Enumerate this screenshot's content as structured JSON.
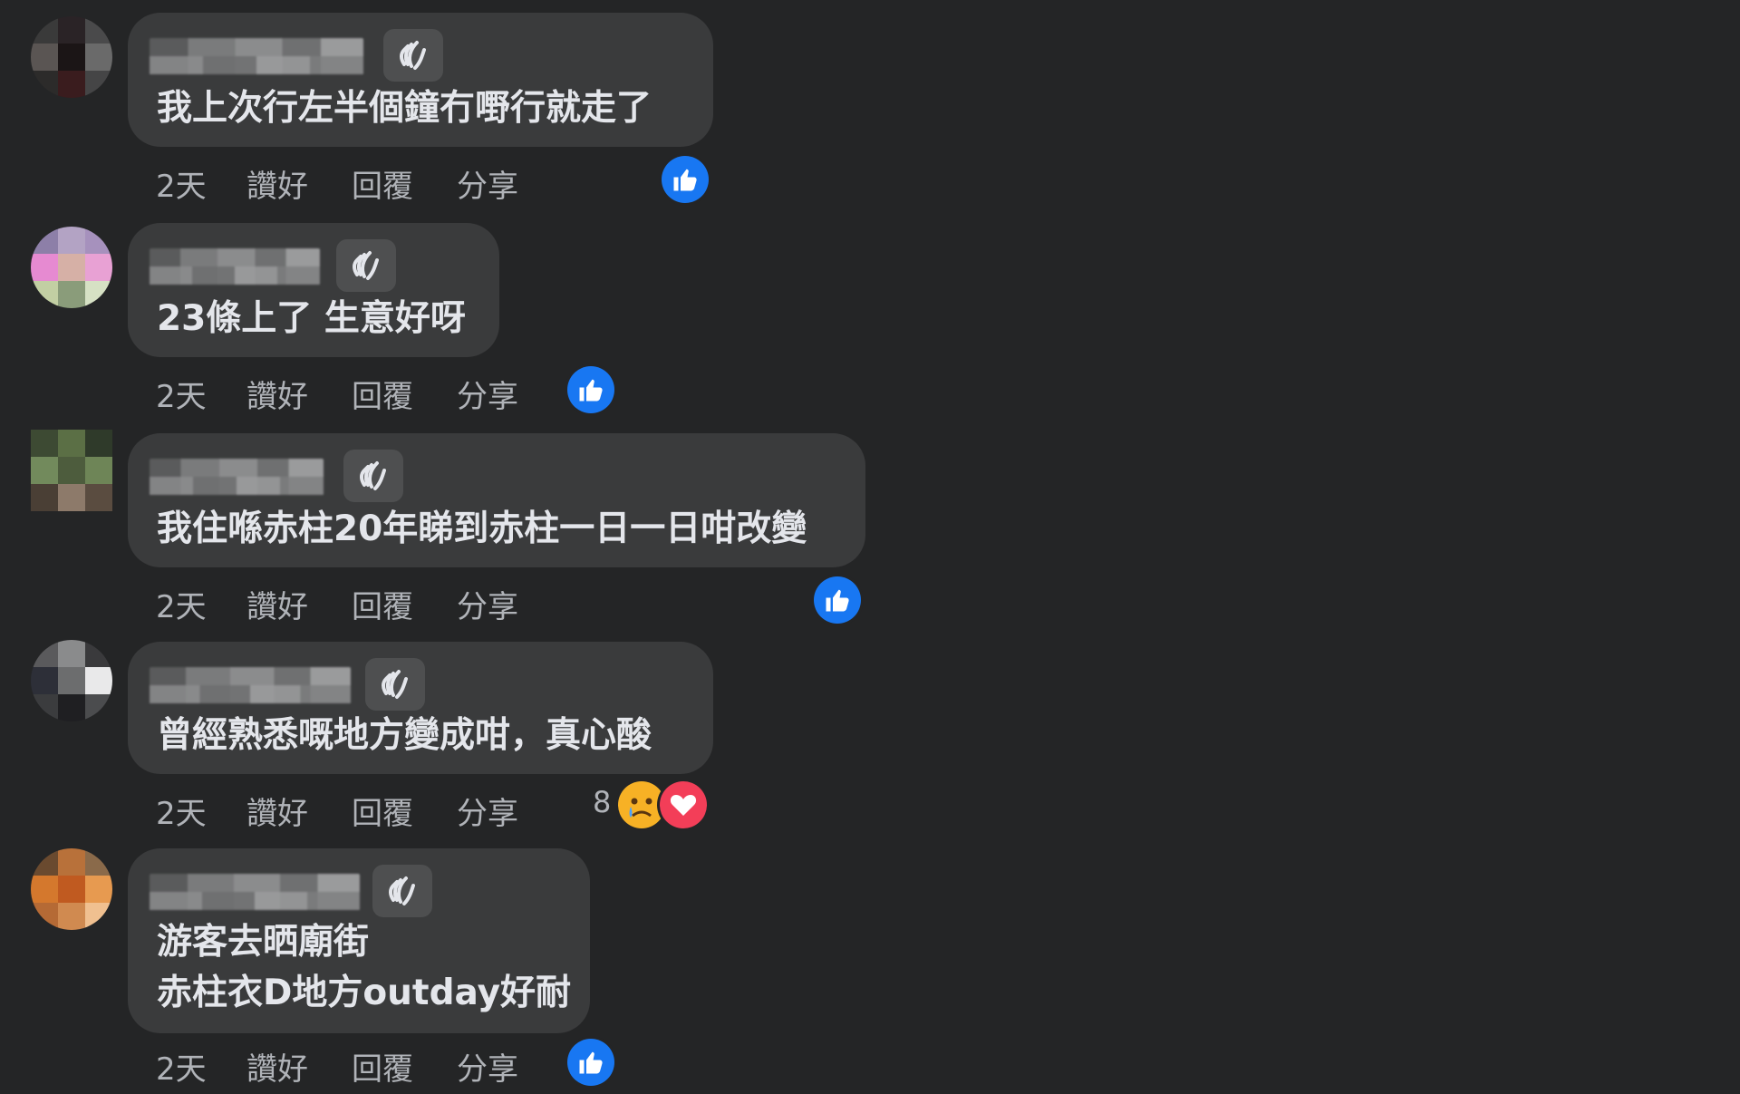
{
  "colors": {
    "background": "#242526",
    "bubble": "#3a3b3c",
    "text": "#e4e6eb",
    "secondary_text": "#b0b3b8",
    "like_blue": "#1877f2",
    "love_red": "#f33e58"
  },
  "actions": {
    "like": "讚好",
    "reply": "回覆",
    "share": "分享"
  },
  "comments": [
    {
      "lines": [
        "我上次行左半個鐘冇嘢行就走了"
      ],
      "time": "2天",
      "reaction_icons": [
        "like-icon"
      ]
    },
    {
      "lines": [
        "23條上了 生意好呀"
      ],
      "time": "2天",
      "reaction_icons": [
        "like-icon"
      ]
    },
    {
      "lines": [
        "我住喺赤柱20年睇到赤柱一日一日咁改變"
      ],
      "time": "2天",
      "reaction_icons": [
        "like-icon"
      ]
    },
    {
      "lines": [
        "曾經熟悉嘅地方變成咁，真心酸"
      ],
      "time": "2天",
      "reaction_count": "8",
      "reaction_icons": [
        "sad-emoji-icon",
        "love-icon"
      ]
    },
    {
      "lines": [
        "游客去晒廟街",
        "赤柱衣D地方outday好耐"
      ],
      "time": "2天",
      "reaction_icons": [
        "like-icon"
      ]
    }
  ]
}
